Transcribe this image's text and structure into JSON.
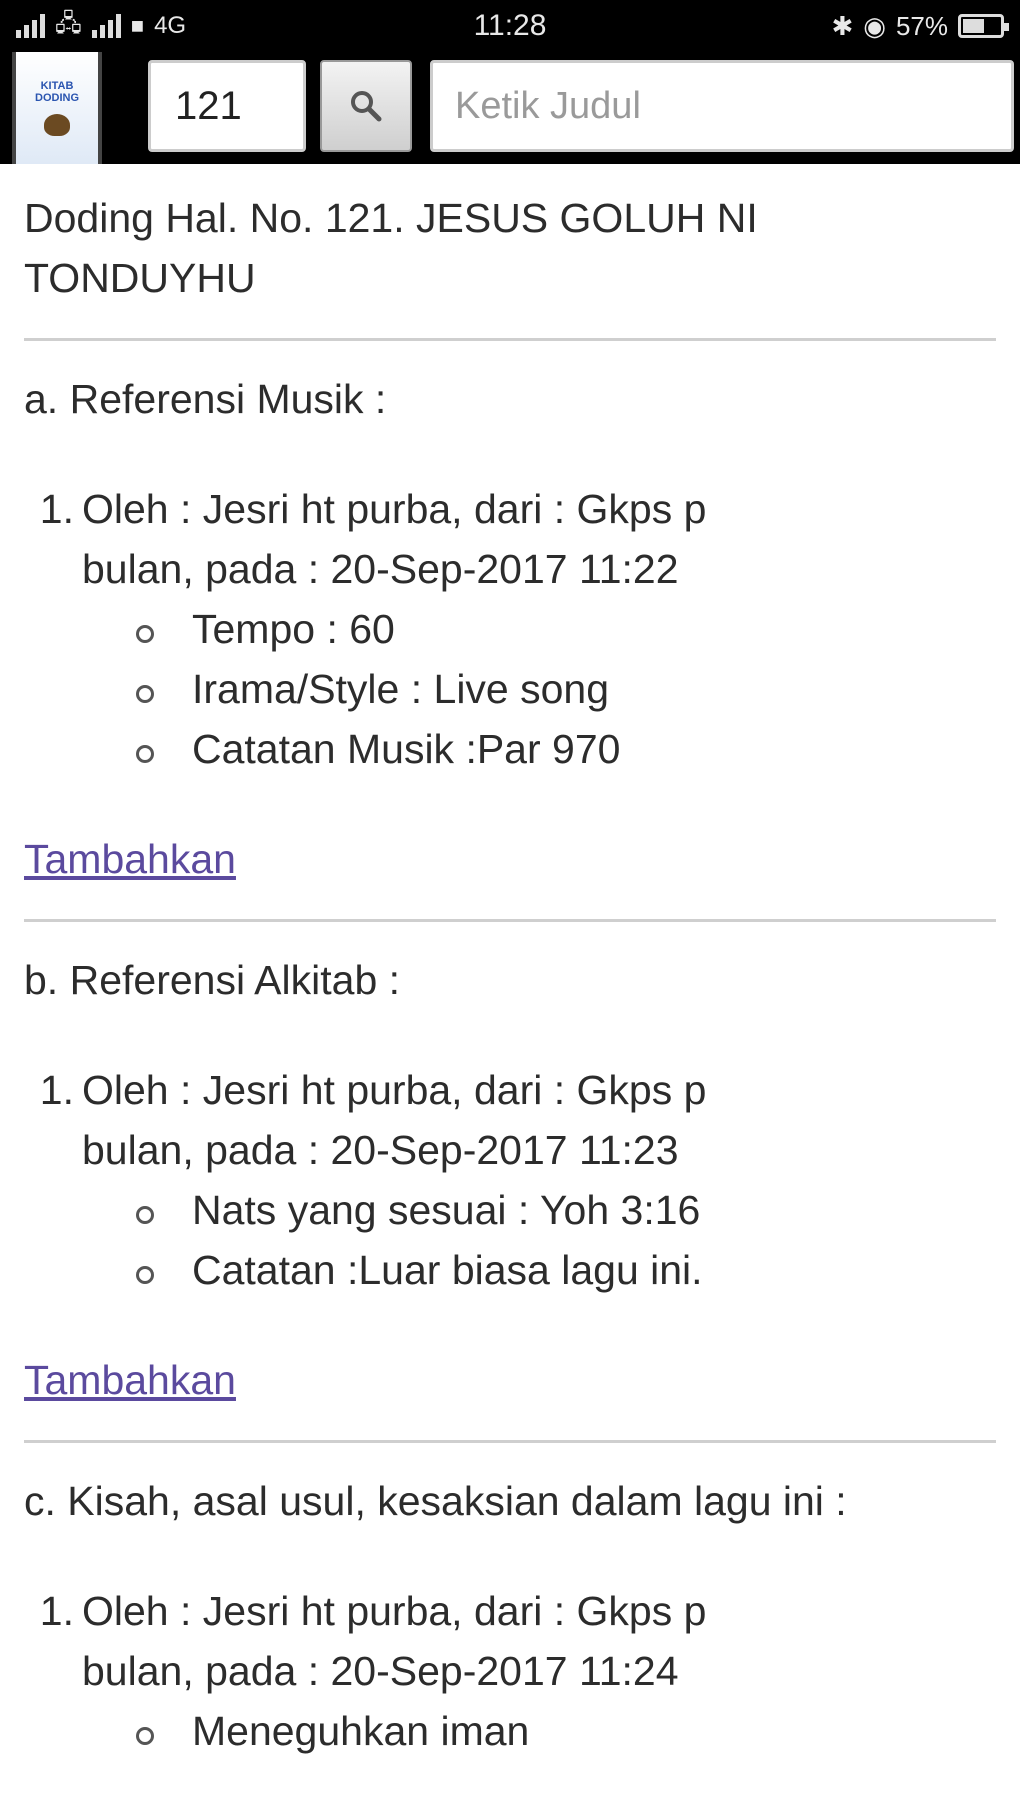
{
  "status_bar": {
    "left_label": "4G",
    "time": "11:28",
    "battery": "57%",
    "battery_level": 0.57
  },
  "toolbar": {
    "logo_text": [
      "KITAB",
      "DODING"
    ],
    "number_value": "121",
    "title_placeholder": "Ketik Judul"
  },
  "song": {
    "title": "Doding Hal. No. 121. JESUS GOLUH NI TONDUYHU"
  },
  "sections": [
    {
      "title": "a. Referensi Musik :",
      "entries": [
        {
          "num": "1.",
          "line1": "Oleh : Jesri ht purba, dari : Gkps p",
          "line2": "bulan, pada : 20-Sep-2017 11:22",
          "items": [
            "Tempo : 60",
            "Irama/Style : Live song",
            "Catatan Musik :Par 970"
          ]
        }
      ],
      "link": "Tambahkan"
    },
    {
      "title": "b. Referensi Alkitab :",
      "entries": [
        {
          "num": "1.",
          "line1": "Oleh : Jesri ht purba, dari : Gkps p",
          "line2": "bulan, pada : 20-Sep-2017 11:23",
          "items": [
            "Nats yang sesuai : Yoh 3:16",
            "Catatan :Luar biasa lagu ini."
          ]
        }
      ],
      "link": "Tambahkan"
    },
    {
      "title": "c. Kisah, asal usul, kesaksian dalam lagu ini :",
      "entries": [
        {
          "num": "1.",
          "line1": "Oleh : Jesri ht purba, dari : Gkps p",
          "line2": "bulan, pada : 20-Sep-2017 11:24",
          "items": [
            "Meneguhkan iman"
          ]
        }
      ]
    }
  ]
}
